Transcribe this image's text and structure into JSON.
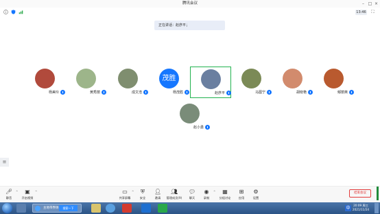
{
  "window": {
    "title": "腾讯会议"
  },
  "status": {
    "clock": "13:46"
  },
  "speaking": {
    "text": "正在讲话：赵彦平；"
  },
  "participants": [
    {
      "name": "杨美玲",
      "avatar_color": "#b14a3c"
    },
    {
      "name": "黄秀丽",
      "avatar_color": "#9db58a"
    },
    {
      "name": "成文浩",
      "avatar_color": "#7f8e6f"
    },
    {
      "name": "杨茂胜",
      "avatar_text": "茂胜",
      "avatar_color": "#1677ff"
    },
    {
      "name": "赵彦平",
      "avatar_color": "#6a7fa0",
      "active": true
    },
    {
      "name": "马图宁",
      "avatar_color": "#7b8a56"
    },
    {
      "name": "胡晓艳",
      "avatar_color": "#d28b6d"
    },
    {
      "name": "郁丽英",
      "avatar_color": "#b95a2f"
    },
    {
      "name": "赵小勇",
      "avatar_color": "#7a8c79"
    }
  ],
  "toolbar": {
    "items": [
      {
        "label": "静音",
        "icon": "mic-icon"
      },
      {
        "label": "开启视频",
        "icon": "camera-off-icon"
      },
      {
        "label": "共享屏幕",
        "icon": "screen-share-icon"
      },
      {
        "label": "安全",
        "icon": "shield-icon"
      },
      {
        "label": "邀请",
        "icon": "invite-icon"
      },
      {
        "label": "管理成员(9)",
        "icon": "members-icon"
      },
      {
        "label": "聊天",
        "icon": "chat-icon"
      },
      {
        "label": "录制",
        "icon": "record-icon"
      },
      {
        "label": "分组讨论",
        "icon": "breakout-icon"
      },
      {
        "label": "应用",
        "icon": "apps-icon"
      },
      {
        "label": "设置",
        "icon": "settings-icon"
      }
    ],
    "end_label": "结束会议",
    "chat_badge": "1"
  },
  "taskbar": {
    "ie_task_label": "主地带界体内聊...",
    "extra_label": "搜索一下",
    "ime": "中",
    "time": "20:09 周三",
    "date": "2021/11/24"
  }
}
